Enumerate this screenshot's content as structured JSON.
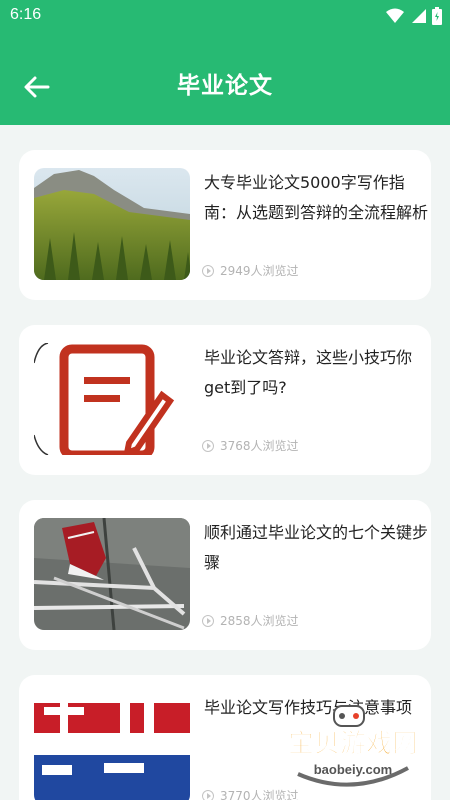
{
  "status_bar": {
    "time": "6:16",
    "icons": [
      "wifi-icon",
      "signal-icon",
      "battery-icon"
    ]
  },
  "header": {
    "title": "毕业论文",
    "back_icon": "arrow-left-icon"
  },
  "articles": [
    {
      "title": "大专毕业论文5000字写作指南：从选题到答辩的全流程解析",
      "views": "2949人浏览过",
      "thumbnail": "forest-mountain-image"
    },
    {
      "title": "毕业论文答辩，这些小技巧你get到了吗?",
      "views": "3768人浏览过",
      "thumbnail": "document-pen-image"
    },
    {
      "title": "顺利通过毕业论文的七个关键步骤",
      "views": "2858人浏览过",
      "thumbnail": "shoe-chalk-arrow-image"
    },
    {
      "title": "毕业论文写作技巧与注意事项",
      "views": "3770人浏览过",
      "thumbnail": "lunwen-poster-image"
    }
  ],
  "watermark": {
    "text": "宝贝游戏网",
    "url": "baobeiy.com"
  },
  "colors": {
    "primary": "#27ba73",
    "background": "#f1f5f4",
    "card": "#ffffff",
    "meta_text": "#b3b3b3"
  }
}
